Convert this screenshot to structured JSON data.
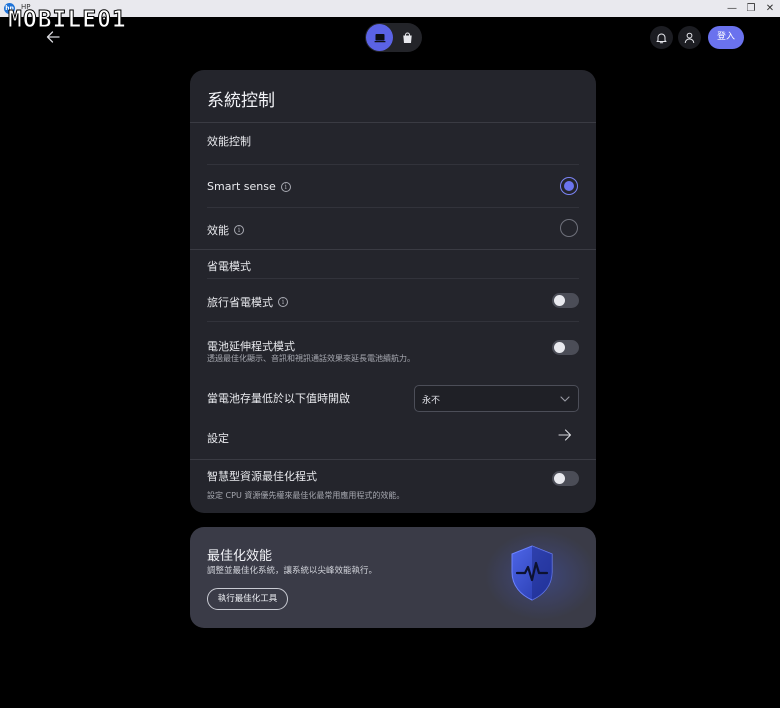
{
  "window": {
    "app_name": "HP",
    "logo_letters": "hp",
    "minimize": "—",
    "maximize": "❐",
    "close": "✕"
  },
  "watermark": "MOBILE01",
  "nav": {
    "back_icon": "arrow-left-icon",
    "segments": [
      {
        "name": "device",
        "icon": "laptop-icon",
        "active": true
      },
      {
        "name": "store",
        "icon": "shopping-bag-icon",
        "active": false
      }
    ],
    "notifications_icon": "bell-icon",
    "account_icon": "user-icon",
    "login_label": "登入"
  },
  "system_control": {
    "title": "系統控制",
    "performance": {
      "heading": "效能控制",
      "options": [
        {
          "label": "Smart sense",
          "selected": true
        },
        {
          "label": "效能",
          "selected": false
        }
      ]
    },
    "power_saving": {
      "heading": "省電模式",
      "travel_mode": {
        "label": "旅行省電模式",
        "enabled": false
      },
      "battery_extender": {
        "label": "電池延伸程式模式",
        "description": "透過最佳化顯示、音訊和視訊通話效果來延長電池續航力。",
        "enabled": false
      },
      "threshold": {
        "label": "當電池存量低於以下值時開啟",
        "value": "永不"
      },
      "settings_label": "設定"
    },
    "smart_optimizer": {
      "label": "智慧型資源最佳化程式",
      "description": "設定 CPU 資源優先權來最佳化最常用應用程式的效能。",
      "enabled": false
    }
  },
  "promo": {
    "title": "最佳化效能",
    "subtitle": "調整並最佳化系統，讓系統以尖峰效能執行。",
    "button_label": "執行最佳化工具",
    "icon": "shield-pulse-icon"
  },
  "colors": {
    "accent": "#6a72ee",
    "card_bg": "#24252c",
    "promo_bg": "#3a3b47",
    "page_bg": "#000000"
  }
}
